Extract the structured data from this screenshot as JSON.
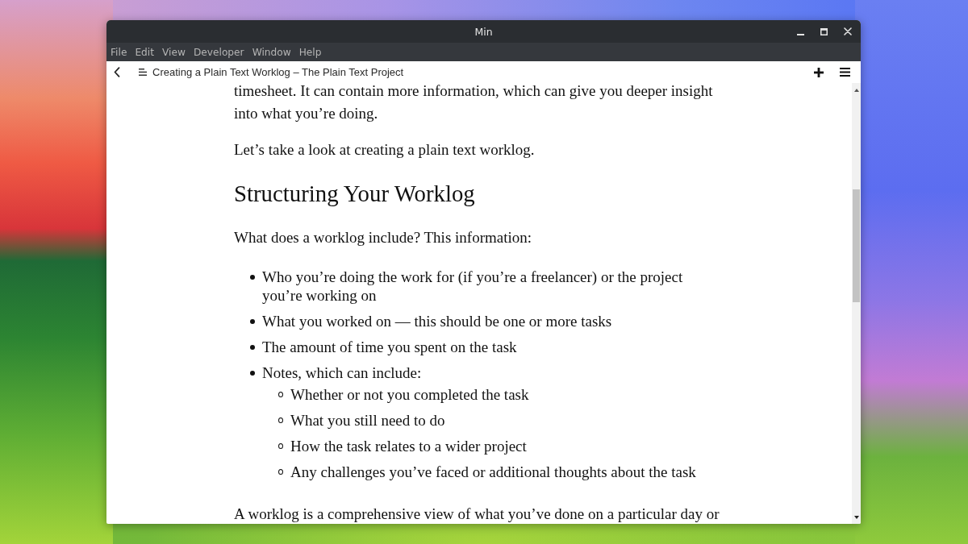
{
  "window": {
    "title": "Min"
  },
  "menu_bar": [
    "File",
    "Edit",
    "View",
    "Developer",
    "Window",
    "Help"
  ],
  "tab_bar": {
    "page_title": "Creating a Plain Text Worklog – The Plain Text Project"
  },
  "article": [
    {
      "kind": "paragraph",
      "text": "timesheet. It can contain more information, which can give you deeper insight into what you’re doing."
    },
    {
      "kind": "paragraph",
      "text": "Let’s take a look at creating a plain text worklog."
    },
    {
      "kind": "heading",
      "text": "Structuring Your Worklog"
    },
    {
      "kind": "paragraph",
      "text": "What does a worklog include? This information:"
    },
    {
      "kind": "list",
      "items": [
        {
          "text": "Who you’re doing the work for (if you’re a freelancer) or the project you’re working on"
        },
        {
          "text": "What you worked on — this should be one or more tasks"
        },
        {
          "text": "The amount of time you spent on the task"
        },
        {
          "text": "Notes, which can include:",
          "children": [
            {
              "text": "Whether or not you completed the task"
            },
            {
              "text": "What you still need to do"
            },
            {
              "text": "How the task relates to a wider project"
            },
            {
              "text": "Any challenges you’ve faced or additional thoughts about the task"
            }
          ]
        }
      ]
    },
    {
      "kind": "paragraph",
      "text": "A worklog is a comprehensive view of what you’ve done on a particular day or"
    }
  ]
}
